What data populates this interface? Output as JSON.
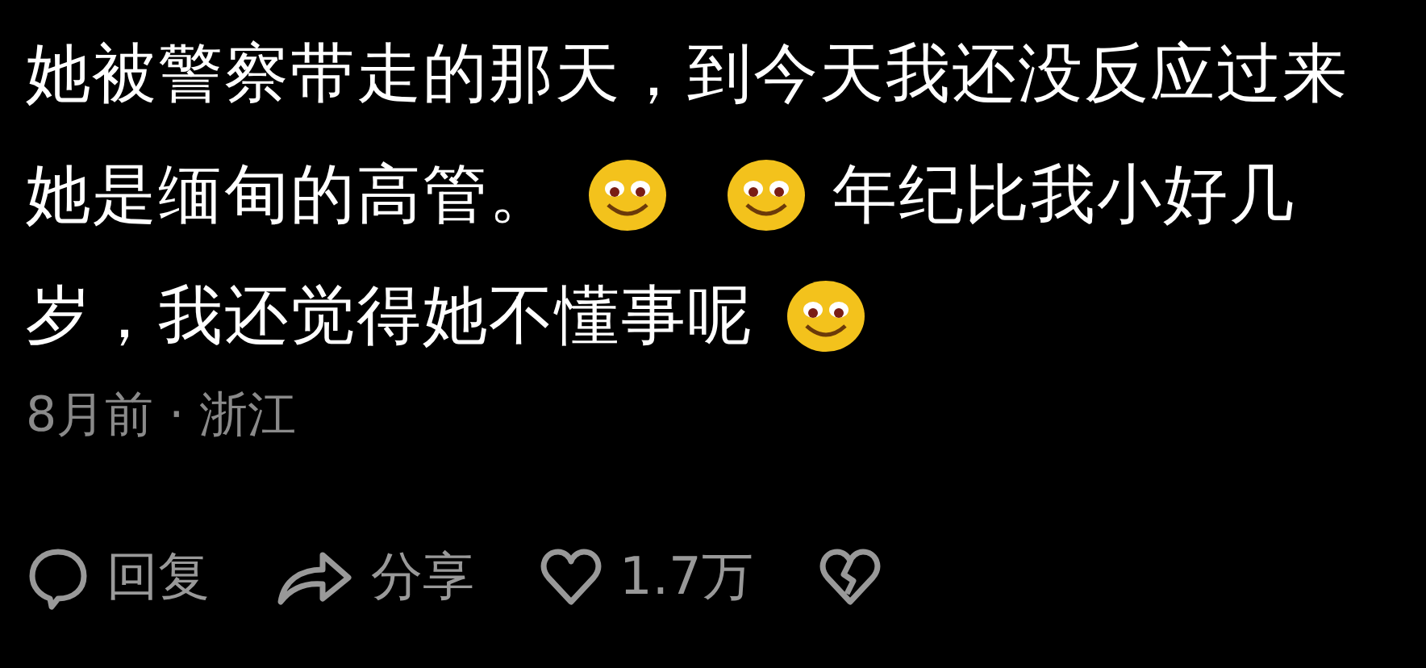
{
  "comment": {
    "lines": [
      [
        {
          "kind": "text",
          "text": "她被警察带走的那天，到今天我还没反应过来"
        }
      ],
      [
        {
          "kind": "text",
          "text": "她是缅甸的高管。"
        },
        {
          "kind": "emoji"
        },
        {
          "kind": "emoji"
        },
        {
          "kind": "text",
          "text": "年纪比我小好几"
        }
      ],
      [
        {
          "kind": "text",
          "text": "岁，我还觉得她不懂事呢"
        },
        {
          "kind": "emoji"
        }
      ]
    ],
    "meta": "8月前 · 浙江",
    "actions": [
      {
        "kind": "reply",
        "label": "回复"
      },
      {
        "kind": "share",
        "label": "分享"
      },
      {
        "kind": "like",
        "label": "1.7万"
      },
      {
        "kind": "dislike"
      }
    ]
  }
}
